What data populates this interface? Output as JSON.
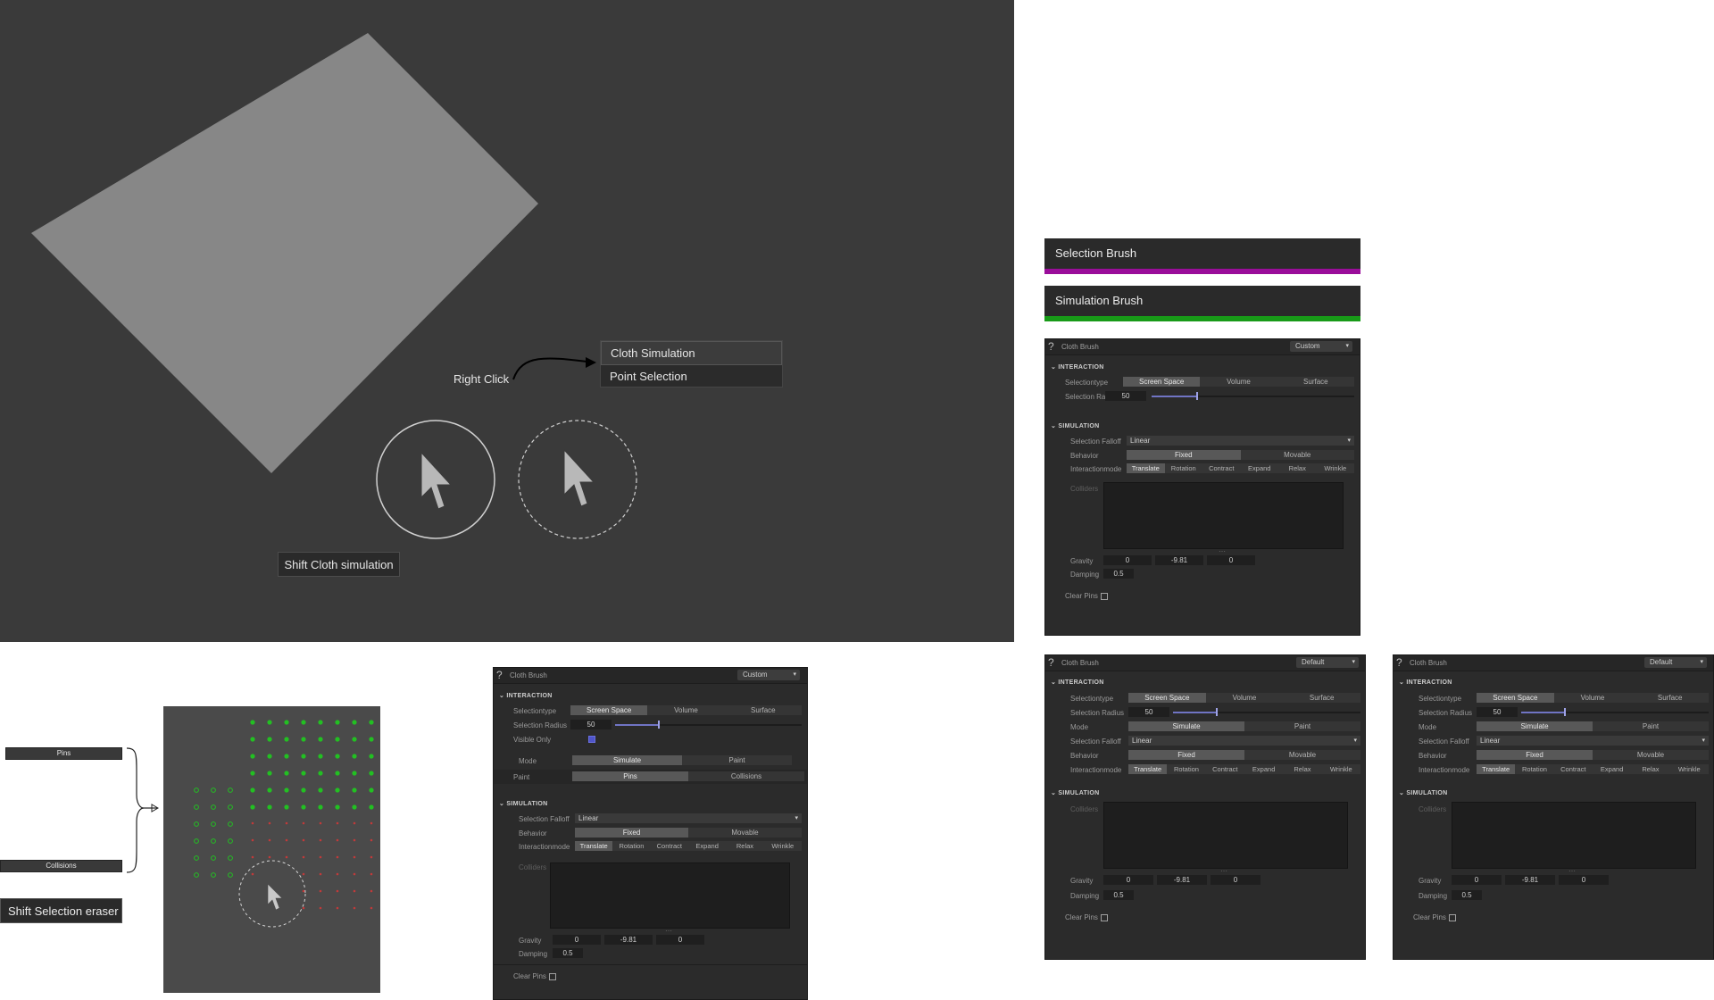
{
  "viewport": {
    "context_menu": {
      "items": [
        "Cloth Simulation",
        "Point Selection"
      ]
    },
    "right_click_label": "Right Click",
    "shift_label": "Shift Cloth simulation"
  },
  "brushes": {
    "selection": {
      "label": "Selection Brush",
      "color": "#9a0d9a"
    },
    "simulation": {
      "label": "Simulation Brush",
      "color": "#189a18"
    }
  },
  "panel": {
    "title": "Cloth Brush",
    "preset_custom": "Custom",
    "preset_default": "Default",
    "interaction": "INTERACTION",
    "simulation": "SIMULATION",
    "selectiontype_label": "Selectiontype",
    "selectiontype_opts": [
      "Screen Space",
      "Volume",
      "Surface"
    ],
    "selection_radius_label": "Selection Radius",
    "selection_radius": "50",
    "visible_only_label": "Visible Only",
    "mode_label": "Mode",
    "mode_opts": [
      "Simulate",
      "Paint"
    ],
    "paint_label": "Paint",
    "paint_opts": [
      "Pins",
      "Collisions"
    ],
    "falloff_label": "Selection Falloff",
    "falloff_value": "Linear",
    "behavior_label": "Behavior",
    "behavior_opts": [
      "Fixed",
      "Movable"
    ],
    "interactionmode_label": "Interactionmode",
    "interactionmode_opts": [
      "Translate",
      "Rotation",
      "Contract",
      "Expand",
      "Relax",
      "Wrinkle"
    ],
    "colliders_label": "Colliders",
    "gravity_label": "Gravity",
    "gravity": [
      "0",
      "-9.81",
      "0"
    ],
    "damping_label": "Damping",
    "damping": "0.5",
    "clear_pins_label": "Clear Pins"
  },
  "bottom_left": {
    "pins_label": "Pins",
    "collisions_label": "Collisions",
    "eraser_label": "Shift Selection eraser"
  },
  "colors": {
    "pin": "#22c022",
    "collision": "#c03a3a",
    "slider": "#7074c4"
  }
}
